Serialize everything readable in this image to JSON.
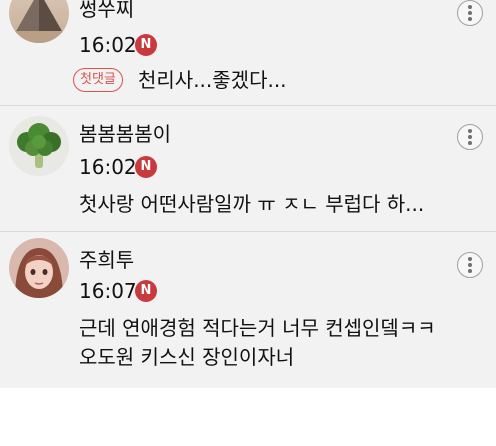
{
  "comments": [
    {
      "username": "썽쑤찌",
      "time": "16:02",
      "new_badge": "N",
      "tag": "첫댓글",
      "text": "천리사...좋겠다...",
      "avatar_icon": "pyramid-avatar"
    },
    {
      "username": "봄봄봄봄이",
      "time": "16:02",
      "new_badge": "N",
      "text": "첫사랑 어떤사람일까 ㅠ ㅈㄴ 부럽다 하...",
      "avatar_icon": "broccoli-avatar"
    },
    {
      "username": "주희투",
      "time": "16:07",
      "new_badge": "N",
      "text_line1": "근데 연애경험 적다는거 너무 컨셉인뎈ㅋㅋ",
      "text_line2": "오도원 키스신 장인이자너",
      "avatar_icon": "anime-girl-avatar"
    }
  ],
  "colors": {
    "background": "#f2f2f2",
    "badge_red": "#c93a3f",
    "tag_red": "#d9534f",
    "divider": "#d9d9d9"
  }
}
